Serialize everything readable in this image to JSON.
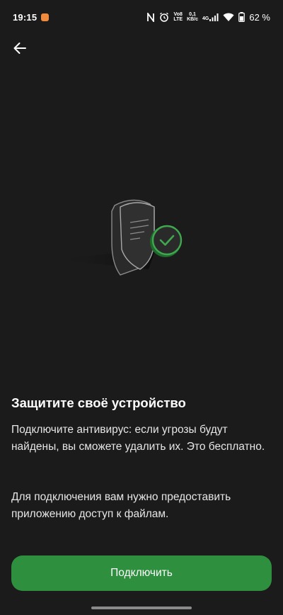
{
  "status_bar": {
    "time": "19:15",
    "volte_top": "Vo8",
    "volte_bottom": "LTE",
    "speed_top": "0,1",
    "speed_bottom": "KB/c",
    "network": "4G",
    "battery": "62 %"
  },
  "header": {
    "back_icon": "arrow-left-icon"
  },
  "illustration": {
    "icon": "shield-check-icon",
    "accent_color": "#2e8f3e"
  },
  "content": {
    "title": "Защитите своё устройство",
    "paragraph_1": "Подключите антивирус: если угрозы будут найдены, вы сможете удалить их. Это бесплатно.",
    "paragraph_2": "Для подключения вам нужно предоставить приложению доступ к файлам."
  },
  "actions": {
    "connect_label": "Подключить"
  },
  "colors": {
    "background": "#1b1b1b",
    "button": "#2e8f3e",
    "text": "#ffffff"
  }
}
